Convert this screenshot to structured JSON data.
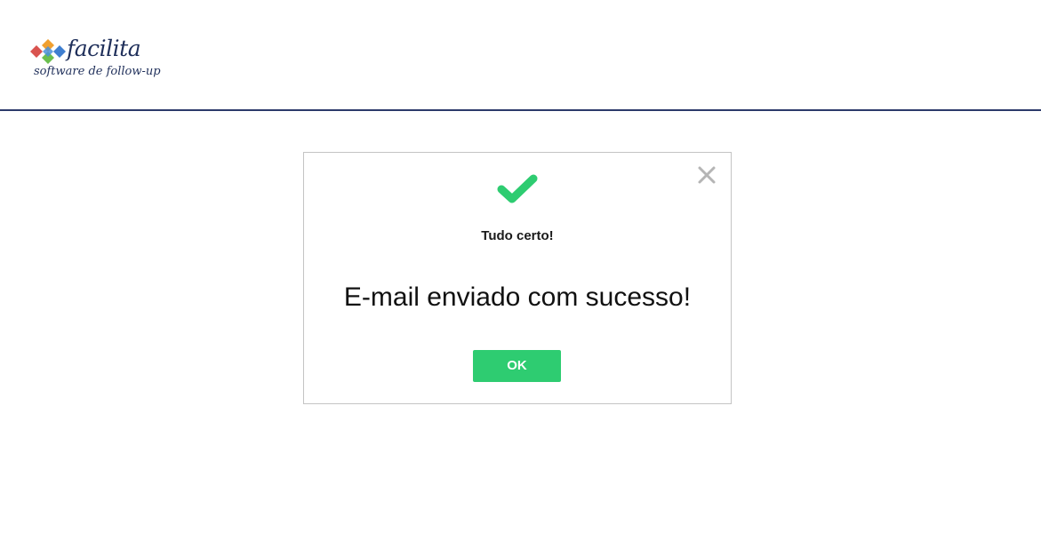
{
  "header": {
    "logo": {
      "name": "facilita",
      "tagline": "software de follow-up",
      "icon": "diamond-cluster-logo-icon",
      "colors": {
        "text": "#1f2f5a",
        "orange": "#f0a030",
        "blue": "#3f7fd0",
        "green": "#6bbf4e",
        "red": "#d9534f"
      }
    },
    "divider_color": "#2c3a6b"
  },
  "modal": {
    "status_icon": "check-icon",
    "status_color": "#2ecc71",
    "title": "Tudo certo!",
    "message": "E-mail enviado com sucesso!",
    "ok_label": "OK",
    "ok_color": "#2ecc71",
    "close_icon": "close-icon",
    "close_color": "#b5b5b5"
  }
}
